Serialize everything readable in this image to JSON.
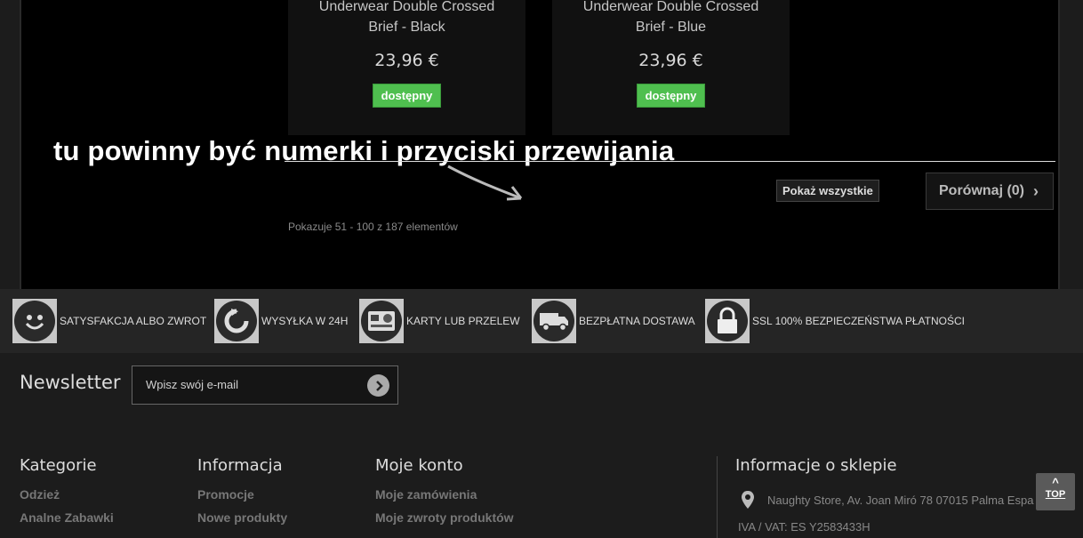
{
  "products": [
    {
      "name": "Underwear Double Crossed Brief - Black",
      "price": "23,96 €",
      "availability": "dostępny"
    },
    {
      "name": "Underwear Double Crossed Brief - Blue",
      "price": "23,96 €",
      "availability": "dostępny"
    }
  ],
  "annotation": "tu powinny być numerki i przyciski przewijania",
  "listing": {
    "show_all": "Pokaż wszystkie",
    "compare_label": "Porównaj (0)",
    "count_text": "Pokazuje 51 - 100 z 187 elementów"
  },
  "features": [
    {
      "label": "SATYSFAKCJA ALBO ZWROT",
      "icon": "smiley-icon"
    },
    {
      "label": "WYSYŁKA W 24H",
      "icon": "refresh-icon"
    },
    {
      "label": "KARTY LUB PRZELEW",
      "icon": "card-icon"
    },
    {
      "label": "BEZPŁATNA DOSTAWA",
      "icon": "truck-icon"
    },
    {
      "label": "SSL 100% BEZPIECZEŃSTWA PŁATNOŚCI",
      "icon": "lock-icon"
    }
  ],
  "newsletter": {
    "title": "Newsletter",
    "placeholder": "Wpisz swój e-mail"
  },
  "footer": {
    "categories": {
      "title": "Kategorie",
      "links": [
        "Odzież",
        "Analne Zabawki"
      ]
    },
    "info": {
      "title": "Informacja",
      "links": [
        "Promocje",
        "Nowe produkty"
      ]
    },
    "account": {
      "title": "Moje konto",
      "links": [
        "Moje zamówienia",
        "Moje zwroty produktów"
      ]
    },
    "store": {
      "title": "Informacje o sklepie",
      "address": "Naughty Store, Av. Joan Miró 78 07015 Palma Espa",
      "vat": "IVA / VAT: ES Y2583433H"
    }
  },
  "top_button": "TOP",
  "colors": {
    "available": "#4fbf4f",
    "background": "#1c1c1c"
  }
}
